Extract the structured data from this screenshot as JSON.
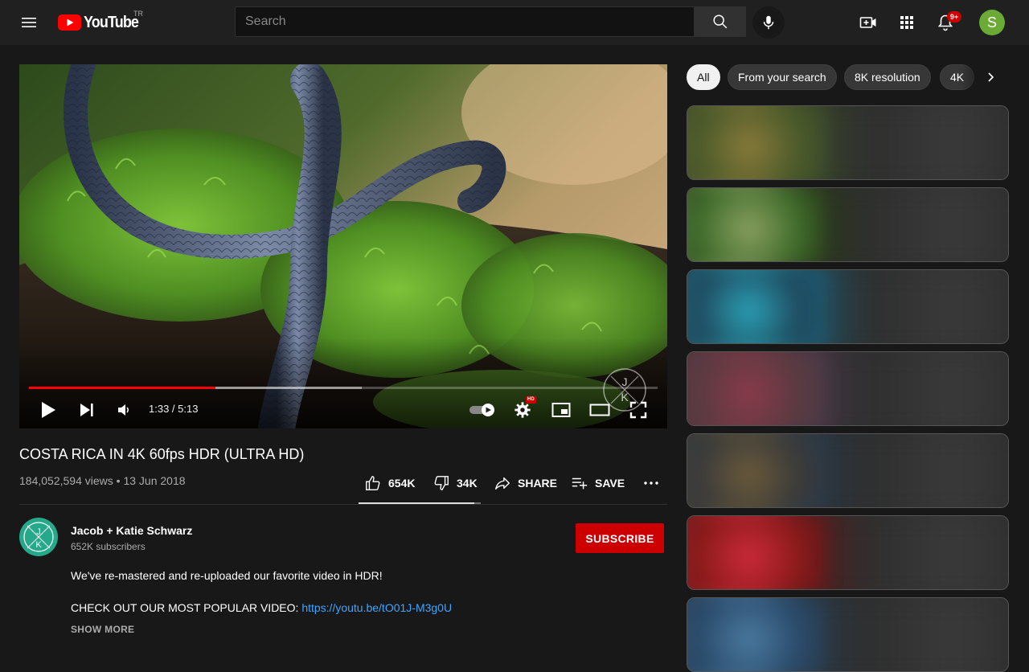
{
  "header": {
    "logo_text": "YouTube",
    "region_code": "TR",
    "search_placeholder": "Search",
    "notification_count": "9+",
    "avatar_letter": "S"
  },
  "player": {
    "current_time": "1:33",
    "time_separator": " / ",
    "duration": "5:13",
    "hd_label": "HD",
    "progress_fraction": 0.297,
    "buffered_fraction": 0.53,
    "autoplay": true
  },
  "video": {
    "title": "COSTA RICA IN 4K 60fps HDR (ULTRA HD)",
    "views": "184,052,594 views",
    "meta_separator": " • ",
    "date": "13 Jun 2018",
    "likes": "654K",
    "dislikes": "34K",
    "share_label": "SHARE",
    "save_label": "SAVE",
    "like_ratio": 0.95
  },
  "channel": {
    "name": "Jacob + Katie Schwarz",
    "subscribers": "652K subscribers",
    "subscribe_label": "SUBSCRIBE",
    "monogram_top": "J",
    "monogram_bottom": "K"
  },
  "description": {
    "line1": "We've re-mastered and re-uploaded our favorite video in HDR!",
    "line2_prefix": "CHECK OUT OUR MOST POPULAR VIDEO: ",
    "line2_link": "https://youtu.be/tO01J-M3g0U",
    "show_more": "SHOW MORE"
  },
  "sidebar": {
    "chips": [
      "All",
      "From your search",
      "8K resolution",
      "4K"
    ],
    "active_chip": "All",
    "recommendations": [
      {
        "thumb_colors": [
          "#4a5a2a",
          "#8a7a3a",
          "#3a4a2a"
        ]
      },
      {
        "thumb_colors": [
          "#3d6a2a",
          "#8aa060",
          "#2a3a1a"
        ]
      },
      {
        "thumb_colors": [
          "#1f4a5e",
          "#2aa0b5",
          "#1e5a70"
        ]
      },
      {
        "thumb_colors": [
          "#5a3a40",
          "#8a3a4a",
          "#4a3a4a"
        ]
      },
      {
        "thumb_colors": [
          "#3a3a3a",
          "#6a5a3a",
          "#2a3a4a"
        ]
      },
      {
        "thumb_colors": [
          "#8a1a1a",
          "#cc2a3a",
          "#5a1a1a"
        ]
      },
      {
        "thumb_colors": [
          "#2a4a6a",
          "#4a7aa0",
          "#2a3a4a"
        ]
      }
    ]
  },
  "colors": {
    "accent_red": "#cc0000",
    "progress_red": "#ff0000",
    "link_blue": "#3ea6ff",
    "background": "#181818"
  }
}
